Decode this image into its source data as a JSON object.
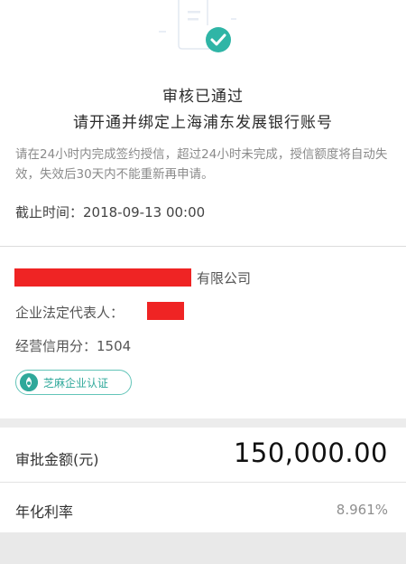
{
  "status": {
    "title": "审核已通过",
    "subtitle": "请开通并绑定上海浦东发展银行账号",
    "notice": "请在24小时内完成签约授信，超过24小时未完成，授信额度将自动失效，失效后30天内不能重新再申请。",
    "deadline": "截止时间：2018-09-13 00:00"
  },
  "company": {
    "name_suffix": "有限公司",
    "legal_rep_label": "企业法定代表人：",
    "credit_score": "经营信用分：1504",
    "badge_label": "芝麻企业认证"
  },
  "loan": {
    "amount_label": "审批金额(元)",
    "amount_value": "150,000.00",
    "rate_label": "年化利率",
    "rate_value": "8.961%"
  },
  "colors": {
    "accent": "#2fa89a",
    "redaction": "#ef2424"
  }
}
